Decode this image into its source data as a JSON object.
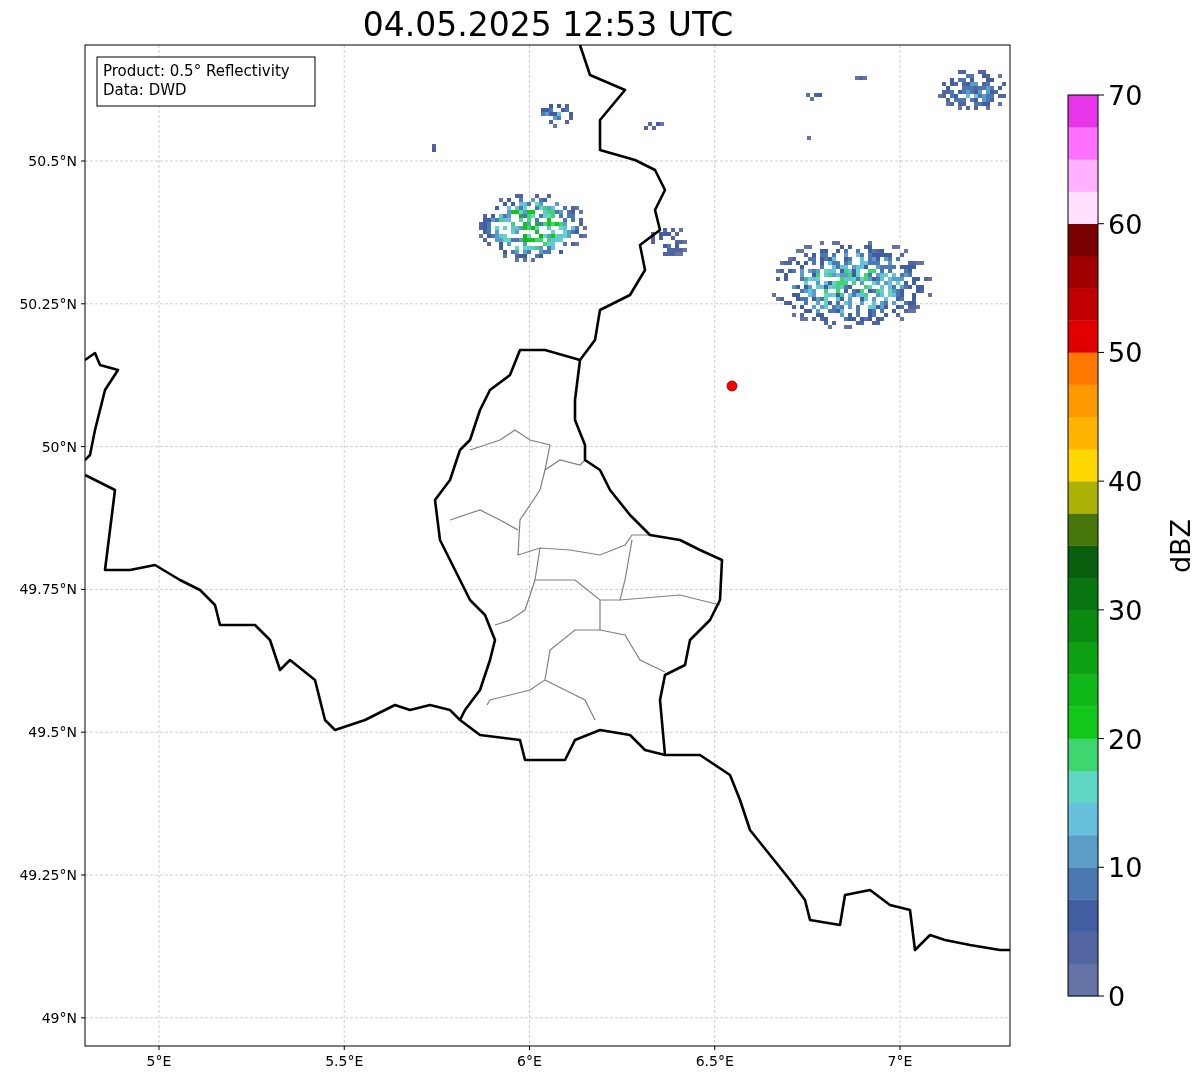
{
  "title": "04.05.2025 12:53 UTC",
  "map": {
    "info": [
      "Product: 0.5° Reflectivity",
      "Data: DWD"
    ],
    "lon_ticks": [
      "5°E",
      "5.5°E",
      "6°E",
      "6.5°E",
      "7°E"
    ],
    "lat_ticks": [
      "50.5°N",
      "50.25°N",
      "50°N",
      "49.75°N",
      "49.5°N",
      "49.25°N",
      "49°N"
    ]
  },
  "colorbar": {
    "label": "dBZ",
    "ticks": [
      "70",
      "60",
      "50",
      "40",
      "30",
      "20",
      "10",
      "0"
    ],
    "bins": [
      {
        "color": "#6474a6"
      },
      {
        "color": "#5265a0"
      },
      {
        "color": "#415ea3"
      },
      {
        "color": "#4b78b0"
      },
      {
        "color": "#5a9ec8"
      },
      {
        "color": "#66c0de"
      },
      {
        "color": "#60d7c5"
      },
      {
        "color": "#3ed66e"
      },
      {
        "color": "#11c71a"
      },
      {
        "color": "#10b81a"
      },
      {
        "color": "#0fa114"
      },
      {
        "color": "#0b8a12"
      },
      {
        "color": "#0a7510"
      },
      {
        "color": "#08600e"
      },
      {
        "color": "#46760a"
      },
      {
        "color": "#adb106"
      },
      {
        "color": "#ffd700"
      },
      {
        "color": "#ffb400"
      },
      {
        "color": "#ff9900"
      },
      {
        "color": "#ff7800"
      },
      {
        "color": "#e10000"
      },
      {
        "color": "#c00000"
      },
      {
        "color": "#a00000"
      },
      {
        "color": "#780000"
      },
      {
        "color": "#ffe0ff"
      },
      {
        "color": "#ffb0ff"
      },
      {
        "color": "#ff70ff"
      },
      {
        "color": "#e935ea"
      }
    ]
  }
}
